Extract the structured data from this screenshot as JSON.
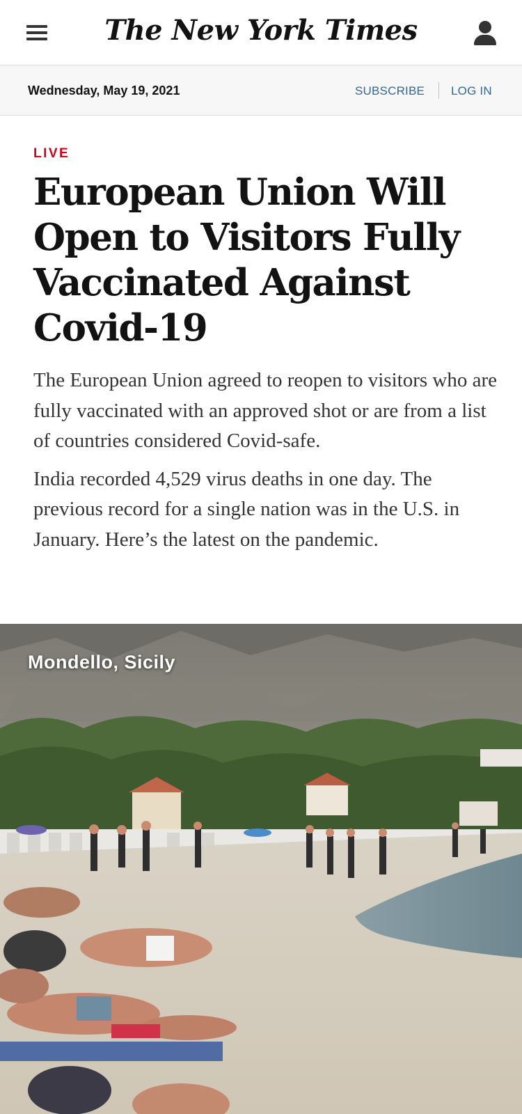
{
  "header": {
    "menu_icon": "hamburger-menu-icon",
    "logo_text": "The New York Times",
    "account_icon": "user-account-icon"
  },
  "datebar": {
    "date": "Wednesday, May 19, 2021",
    "subscribe_label": "SUBSCRIBE",
    "login_label": "LOG IN",
    "link_color": "#326891"
  },
  "article": {
    "kicker": "LIVE",
    "kicker_color": "#d0021b",
    "headline": "European Union Will Open to Visitors Fully Vaccinated Against Covid-19",
    "summary": [
      "The European Union agreed to reopen to visitors who are fully vaccinated with an approved shot or are from a list of countries considered Covid-safe.",
      "India recorded 4,529 virus deaths in one day. The previous record for a single nation was in the U.S. in January. Here’s the latest on the pandemic."
    ]
  },
  "photo": {
    "location_label": "Mondello, Sicily"
  }
}
